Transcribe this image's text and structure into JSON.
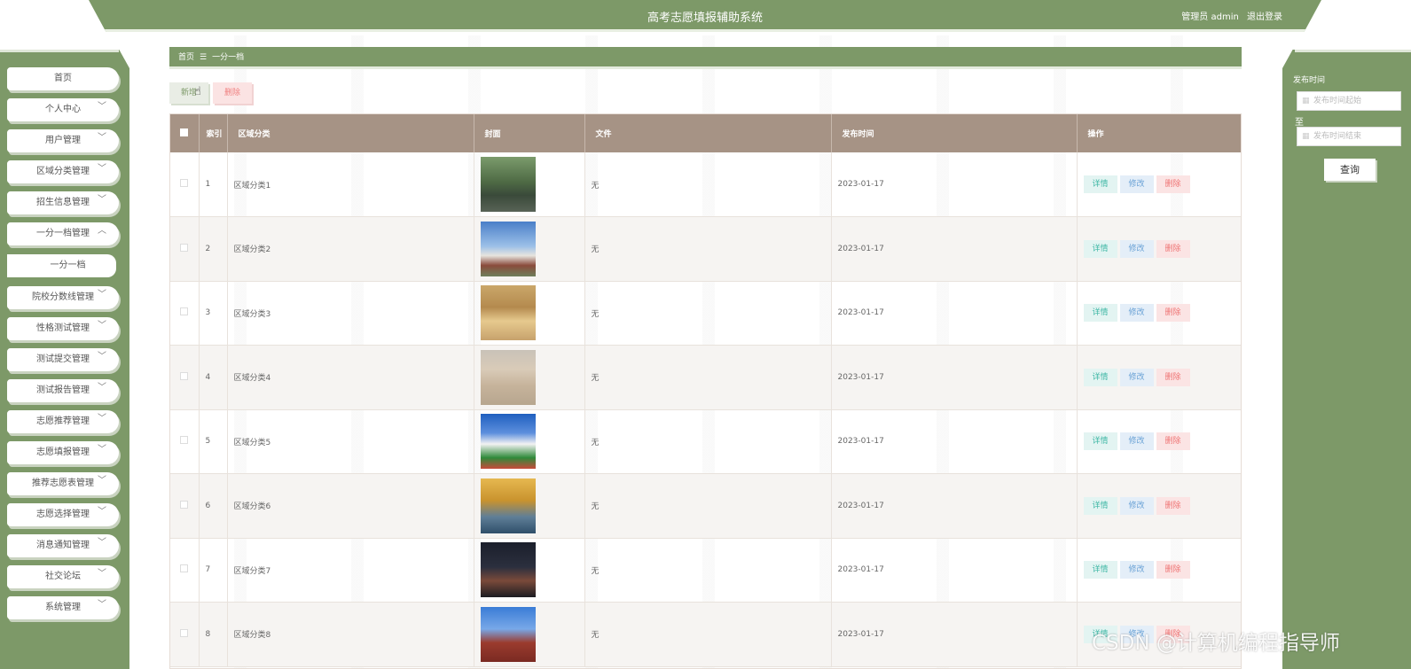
{
  "header": {
    "title": "高考志愿填报辅助系统",
    "user_role": "管理员 admin",
    "logout": "退出登录"
  },
  "sidebar": {
    "items": [
      {
        "label": "首页",
        "chevron": ""
      },
      {
        "label": "个人中心",
        "chevron": "﹀"
      },
      {
        "label": "用户管理",
        "chevron": "﹀"
      },
      {
        "label": "区域分类管理",
        "chevron": "﹀"
      },
      {
        "label": "招生信息管理",
        "chevron": "﹀"
      },
      {
        "label": "一分一档管理",
        "chevron": "︿"
      },
      {
        "label": "一分一档",
        "chevron": ""
      },
      {
        "label": "院校分数线管理",
        "chevron": "﹀"
      },
      {
        "label": "性格测试管理",
        "chevron": "﹀"
      },
      {
        "label": "测试提交管理",
        "chevron": "﹀"
      },
      {
        "label": "测试报告管理",
        "chevron": "﹀"
      },
      {
        "label": "志愿推荐管理",
        "chevron": "﹀"
      },
      {
        "label": "志愿填报管理",
        "chevron": "﹀"
      },
      {
        "label": "推荐志愿表管理",
        "chevron": "﹀"
      },
      {
        "label": "志愿选择管理",
        "chevron": "﹀"
      },
      {
        "label": "消息通知管理",
        "chevron": "﹀"
      },
      {
        "label": "社交论坛",
        "chevron": "﹀"
      },
      {
        "label": "系统管理",
        "chevron": "﹀"
      }
    ]
  },
  "breadcrumb": {
    "home": "首页",
    "sep": "☰",
    "current": "一分一档"
  },
  "toolbar": {
    "add_label": "新增",
    "delete_label": "删除"
  },
  "table": {
    "headers": {
      "index": "索引",
      "region": "区域分类",
      "cover": "封面",
      "file": "文件",
      "date": "发布时间",
      "ops": "操作"
    },
    "ops": {
      "detail": "详情",
      "edit": "修改",
      "delete": "删除"
    },
    "rows": [
      {
        "index": "1",
        "region": "区域分类1",
        "file": "无",
        "date": "2023-01-17"
      },
      {
        "index": "2",
        "region": "区域分类2",
        "file": "无",
        "date": "2023-01-17"
      },
      {
        "index": "3",
        "region": "区域分类3",
        "file": "无",
        "date": "2023-01-17"
      },
      {
        "index": "4",
        "region": "区域分类4",
        "file": "无",
        "date": "2023-01-17"
      },
      {
        "index": "5",
        "region": "区域分类5",
        "file": "无",
        "date": "2023-01-17"
      },
      {
        "index": "6",
        "region": "区域分类6",
        "file": "无",
        "date": "2023-01-17"
      },
      {
        "index": "7",
        "region": "区域分类7",
        "file": "无",
        "date": "2023-01-17"
      },
      {
        "index": "8",
        "region": "区域分类8",
        "file": "无",
        "date": "2023-01-17"
      }
    ]
  },
  "filter": {
    "label": "发布时间",
    "start_placeholder": "发布时间起始",
    "end_placeholder": "发布时间结束",
    "separator": "至",
    "query_label": "查询"
  },
  "watermark": "CSDN @计算机编程指导师",
  "colors": {
    "brand": "#7d9968",
    "table_header": "#a69385",
    "detail": "#3fb7a5",
    "edit": "#6aa2d6",
    "delete": "#ef7575"
  }
}
